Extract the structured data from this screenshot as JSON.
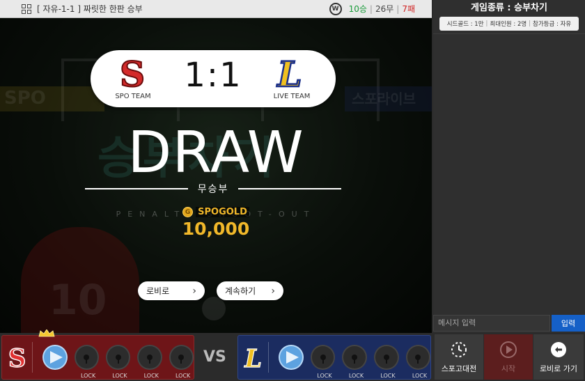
{
  "header": {
    "room_title": "[ 자유-1-1 ]  짜릿한 한판 승부",
    "record_win": "10승",
    "record_draw": "26무",
    "record_loss": "7패",
    "separator": "|"
  },
  "stage": {
    "banner_left_text": "SPO",
    "banner_right_text": "스포라이브",
    "bg_logo_text": "승부차기",
    "player_number": "10"
  },
  "scoreboard": {
    "home_team_letter": "S",
    "home_team_name": "SPO TEAM",
    "away_team_letter": "L",
    "away_team_name": "LIVE TEAM",
    "score": "1:1"
  },
  "result": {
    "title": "DRAW",
    "subtitle": "무승부",
    "ghost_text": "PENALTY SHOOT-OUT",
    "gold_label": "SPOGOLD",
    "gold_coin": "G",
    "gold_amount": "10,000"
  },
  "buttons": {
    "lobby": "로비로",
    "continue": "계속하기",
    "chevron": "›"
  },
  "side_panel": {
    "title": "게임종류 : 승부차기",
    "seed_gold": "시드골드 : 1만",
    "max_players": "최대인원 : 2명",
    "join_level": "참가등급 : 자유",
    "bar": "|",
    "message_placeholder": "메시지 입력",
    "send_label": "입력"
  },
  "bottom_bar": {
    "vs_label": "VS",
    "lock_label": "LOCK",
    "home_letter": "S",
    "away_letter": "L",
    "actions": {
      "spo_match": "스포고대전",
      "start": "시작",
      "to_lobby": "로비로 가기"
    }
  },
  "colors": {
    "red_team": "#6e1518",
    "blue_team": "#1b2c60",
    "gold": "#f1b82a",
    "send_button": "#1560c7"
  }
}
